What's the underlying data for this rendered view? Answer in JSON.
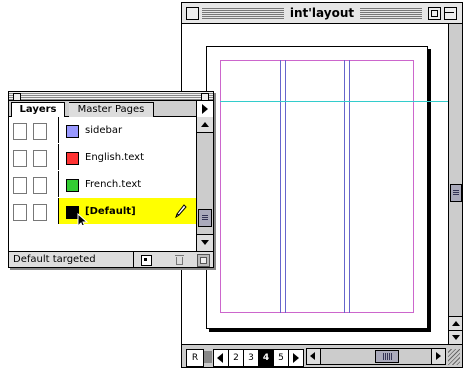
{
  "document": {
    "title": "int'layout",
    "pages": [
      {
        "label": "R",
        "state": "normal"
      },
      {
        "label": "2",
        "state": "normal"
      },
      {
        "label": "3",
        "state": "normal"
      },
      {
        "label": "4",
        "state": "selected"
      },
      {
        "label": "5",
        "state": "normal"
      }
    ]
  },
  "palette": {
    "tabs": [
      {
        "label": "Layers",
        "active": true
      },
      {
        "label": "Master Pages",
        "active": false
      }
    ],
    "layers": [
      {
        "name": "sidebar",
        "color": "#9999ff",
        "selected": false
      },
      {
        "name": "English.text",
        "color": "#ff3333",
        "selected": false
      },
      {
        "name": "French.text",
        "color": "#33cc33",
        "selected": false
      },
      {
        "name": "[Default]",
        "color": "#000000",
        "selected": true
      }
    ],
    "selected_bg": "#ffff00",
    "status_text": "Default targeted",
    "icons": [
      "new-layer-icon",
      "trash-icon",
      "options-icon",
      "pencil-icon",
      "arrow-cursor-icon"
    ]
  },
  "guide_colors": {
    "margin": "#cc66cc",
    "column": "#6666cc",
    "ruler_guide": "#33cccc"
  }
}
